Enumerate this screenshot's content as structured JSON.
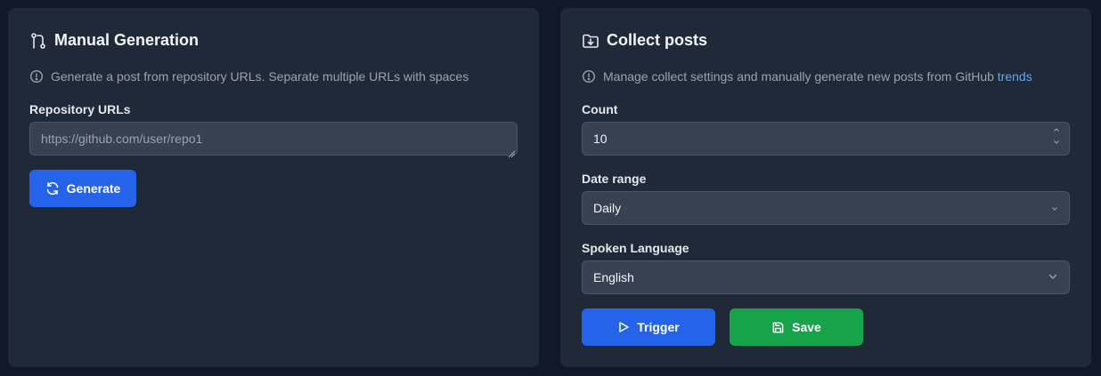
{
  "manual": {
    "title": "Manual Generation",
    "info": "Generate a post from repository URLs. Separate multiple URLs with spaces",
    "repo_label": "Repository URLs",
    "repo_placeholder": "https://github.com/user/repo1",
    "generate_label": "Generate"
  },
  "collect": {
    "title": "Collect posts",
    "info_prefix": "Manage collect settings and manually generate new posts from GitHub ",
    "info_link": "trends",
    "count_label": "Count",
    "count_value": "10",
    "date_label": "Date range",
    "date_value": "Daily",
    "lang_label": "Spoken Language",
    "lang_value": "English",
    "trigger_label": "Trigger",
    "save_label": "Save"
  },
  "colors": {
    "background": "#111827",
    "card": "#1f2937",
    "primary": "#2563eb",
    "success": "#16a34a",
    "link": "#60a5fa"
  }
}
